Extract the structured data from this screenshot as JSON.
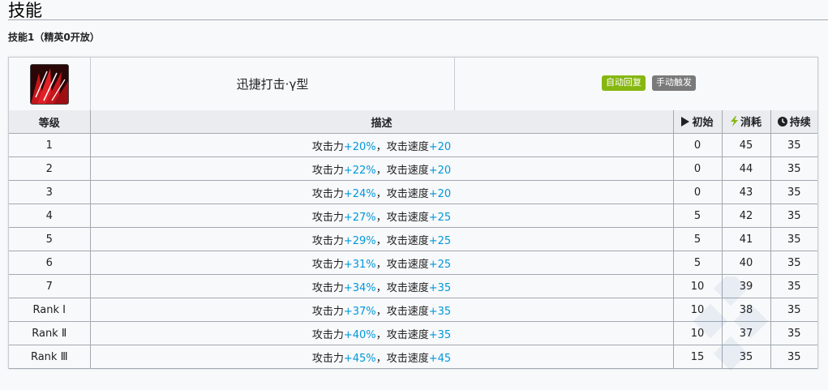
{
  "page": {
    "title": "技能"
  },
  "section": {
    "title": "技能1（精英0开放）"
  },
  "skill": {
    "name": "迅捷打击·γ型",
    "icon": "skill-red-claw-icon",
    "tags": [
      {
        "label": "自动回复",
        "color": "#86b711"
      },
      {
        "label": "手动触发",
        "color": "#7a7a7a"
      }
    ]
  },
  "table": {
    "headers": {
      "level": "等级",
      "description": "描述",
      "initial": "初始",
      "cost": "消耗",
      "duration": "持续"
    },
    "desc_parts": {
      "atk_label": "攻击力",
      "separator": "，",
      "aspd_label": "攻击速度"
    },
    "rows": [
      {
        "level": "1",
        "atk": "+20%",
        "aspd": "+20",
        "initial": "0",
        "cost": "45",
        "duration": "35"
      },
      {
        "level": "2",
        "atk": "+22%",
        "aspd": "+20",
        "initial": "0",
        "cost": "44",
        "duration": "35"
      },
      {
        "level": "3",
        "atk": "+24%",
        "aspd": "+20",
        "initial": "0",
        "cost": "43",
        "duration": "35"
      },
      {
        "level": "4",
        "atk": "+27%",
        "aspd": "+25",
        "initial": "5",
        "cost": "42",
        "duration": "35"
      },
      {
        "level": "5",
        "atk": "+29%",
        "aspd": "+25",
        "initial": "5",
        "cost": "41",
        "duration": "35"
      },
      {
        "level": "6",
        "atk": "+31%",
        "aspd": "+25",
        "initial": "5",
        "cost": "40",
        "duration": "35"
      },
      {
        "level": "7",
        "atk": "+34%",
        "aspd": "+35",
        "initial": "10",
        "cost": "39",
        "duration": "35"
      },
      {
        "level": "Rank Ⅰ",
        "atk": "+37%",
        "aspd": "+35",
        "initial": "10",
        "cost": "38",
        "duration": "35"
      },
      {
        "level": "Rank Ⅱ",
        "atk": "+40%",
        "aspd": "+35",
        "initial": "10",
        "cost": "37",
        "duration": "35"
      },
      {
        "level": "Rank Ⅲ",
        "atk": "+45%",
        "aspd": "+45",
        "initial": "15",
        "cost": "35",
        "duration": "35"
      }
    ]
  },
  "colors": {
    "highlight": "#0098dc",
    "cost_icon": "#86b711",
    "header_bg": "#eaecf0"
  }
}
